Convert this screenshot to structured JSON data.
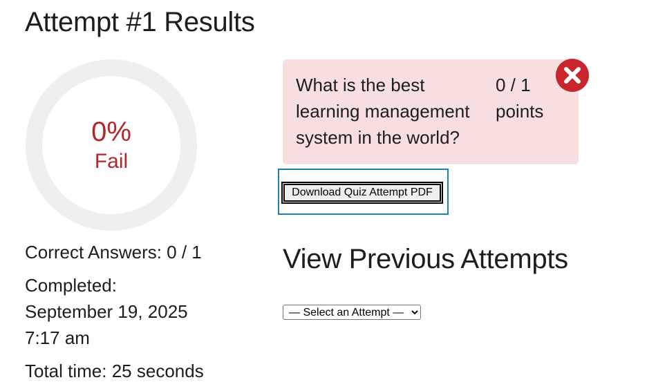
{
  "page": {
    "title": "Attempt #1 Results"
  },
  "score": {
    "percent_text": "0%",
    "percent_value": 0,
    "status": "Fail",
    "ring_track_color": "#efefef",
    "fail_color": "#b2262d"
  },
  "stats": {
    "correct_answers": "Correct Answers: 0 / 1",
    "completed_label": "Completed:",
    "completed_date": "September 19, 2025",
    "completed_time": "7:17 am",
    "total_time": "Total time: 25 seconds"
  },
  "question": {
    "text": "What is the best learning management system in the world?",
    "points": "0 / 1 points",
    "result_icon": "close-circle-icon",
    "card_color": "#f7dedf",
    "icon_color": "#c8252c"
  },
  "actions": {
    "download_label": "Download Quiz Attempt PDF",
    "focus_color": "#1d7fb0"
  },
  "previous_attempts": {
    "heading": "View Previous Attempts",
    "selected": "— Select an Attempt —",
    "options": [
      "— Select an Attempt —"
    ]
  }
}
